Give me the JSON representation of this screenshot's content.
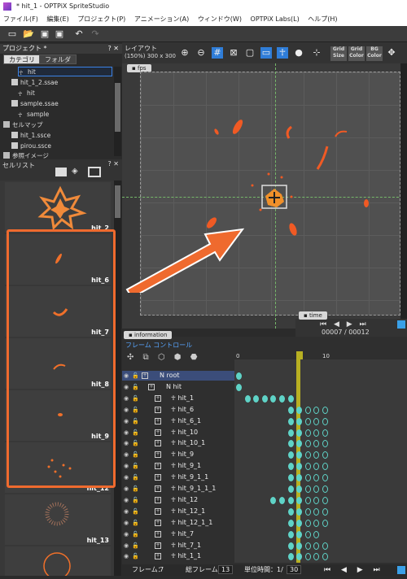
{
  "window": {
    "title": "* hit_1 - OPTPiX SpriteStudio"
  },
  "menu": [
    "ファイル(F)",
    "編集(E)",
    "プロジェクト(P)",
    "アニメーション(A)",
    "ウィンドウ(W)",
    "OPTPiX Labs(L)",
    "ヘルプ(H)"
  ],
  "toolbar": {
    "icons": [
      "new-icon",
      "open-icon",
      "save-icon",
      "save-all-icon",
      "undo-icon",
      "redo-icon"
    ]
  },
  "project": {
    "header": "プロジェクト *",
    "tabs": [
      "カテゴリ",
      "フォルダ"
    ],
    "tree": [
      {
        "label": "hit",
        "selected": true
      },
      {
        "label": "hit_1_2.ssae"
      },
      {
        "label": "hit"
      },
      {
        "label": "sample.ssae"
      },
      {
        "label": "sample"
      },
      {
        "label": "セルマップ"
      },
      {
        "label": "hit_1.ssce"
      },
      {
        "label": "pirou.ssce"
      },
      {
        "label": "参照イメージ"
      }
    ]
  },
  "cell_list": {
    "header": "セルリスト",
    "items": [
      "hit_2",
      "hit_6",
      "hit_7",
      "hit_8",
      "hit_9",
      "hit_12",
      "hit_13",
      ""
    ]
  },
  "layout": {
    "header": "レイアウト",
    "zoom_info": "(150%) 300 x 300",
    "fps_tab": "fps",
    "grid_buttons": [
      "Grid Size",
      "Grid Color",
      "BG Color"
    ]
  },
  "time": {
    "tab": "time",
    "current": "00007",
    "separator": "/",
    "total": "00012"
  },
  "information_tab": "information",
  "frame_control": {
    "header": "フレーム コントロール",
    "ruler": [
      "0",
      "10"
    ],
    "parts": [
      {
        "name": "root",
        "level": 0,
        "group": true
      },
      {
        "name": "hit",
        "level": 1,
        "group": true
      },
      {
        "name": "hit_1",
        "level": 2
      },
      {
        "name": "hit_6",
        "level": 2
      },
      {
        "name": "hit_6_1",
        "level": 2
      },
      {
        "name": "hit_10",
        "level": 2
      },
      {
        "name": "hit_10_1",
        "level": 2
      },
      {
        "name": "hit_9",
        "level": 2
      },
      {
        "name": "hit_9_1",
        "level": 2
      },
      {
        "name": "hit_9_1_1",
        "level": 2
      },
      {
        "name": "hit_9_1_1_1",
        "level": 2
      },
      {
        "name": "hit_12",
        "level": 2
      },
      {
        "name": "hit_12_1",
        "level": 2
      },
      {
        "name": "hit_12_1_1",
        "level": 2
      },
      {
        "name": "hit_7",
        "level": 2
      },
      {
        "name": "hit_7_1",
        "level": 2
      },
      {
        "name": "hit_1_1",
        "level": 2
      }
    ],
    "keyframes": [
      [
        0
      ],
      [
        0
      ],
      [
        1,
        2,
        3,
        4,
        5,
        6
      ],
      [
        6,
        7,
        8,
        9,
        10
      ],
      [
        6,
        7,
        8,
        9,
        10
      ],
      [
        6,
        7,
        8,
        9,
        10
      ],
      [
        6,
        7,
        8,
        9,
        10
      ],
      [
        6,
        7,
        8,
        9,
        10
      ],
      [
        6,
        7,
        8,
        9,
        10
      ],
      [
        6,
        7,
        8,
        9,
        10
      ],
      [
        6,
        7,
        8,
        9,
        10
      ],
      [
        4,
        5,
        6,
        7,
        8,
        9,
        10
      ],
      [
        6,
        7,
        8,
        9,
        10
      ],
      [
        6,
        7,
        8,
        9,
        10
      ],
      [
        6,
        7,
        8,
        9
      ],
      [
        6,
        7,
        8,
        9,
        10
      ],
      [
        6,
        7,
        8,
        9,
        10
      ]
    ]
  },
  "status": {
    "frame_label": "フレーム：",
    "frame_value": "7",
    "total_label": "総フレーム：",
    "total_value": "13",
    "unit_label": "単位時間：1/",
    "unit_value": "30"
  },
  "colors": {
    "accent": "#ef6a2e",
    "keyframe": "#5fd3c7",
    "selection": "#3b82e6"
  }
}
